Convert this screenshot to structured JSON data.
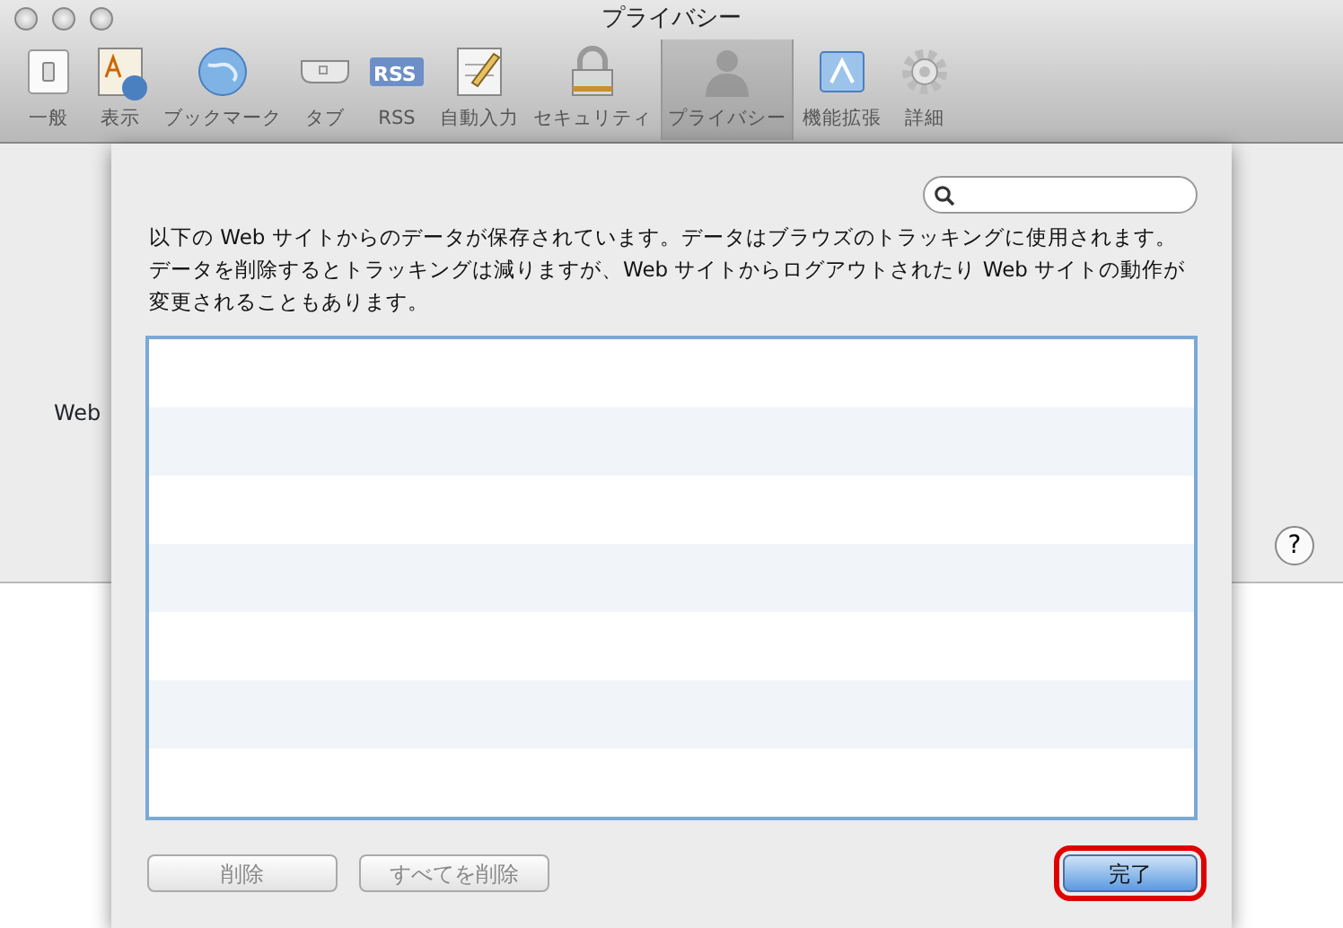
{
  "window": {
    "title": "プライバシー"
  },
  "toolbar": [
    {
      "label": "一般",
      "selected": false
    },
    {
      "label": "表示",
      "selected": false
    },
    {
      "label": "ブックマーク",
      "selected": false
    },
    {
      "label": "タブ",
      "selected": false
    },
    {
      "label": "RSS",
      "icon_text": "RSS",
      "selected": false
    },
    {
      "label": "自動入力",
      "selected": false
    },
    {
      "label": "セキュリティ",
      "selected": false
    },
    {
      "label": "プライバシー",
      "selected": true
    },
    {
      "label": "機能拡張",
      "selected": false
    },
    {
      "label": "詳細",
      "selected": false
    }
  ],
  "background": {
    "label": "Web",
    "help": "?"
  },
  "sheet": {
    "description": "以下の Web サイトからのデータが保存されています。データはブラウズのトラッキングに使用されます。データを削除するとトラッキングは減りますが、Web サイトからログアウトされたり Web サイトの動作が変更されることもあります。",
    "buttons": [
      {
        "label": "削除",
        "disabled": true,
        "default": false,
        "highlighted": false
      },
      {
        "label": "すべてを削除",
        "disabled": true,
        "default": false,
        "highlighted": false
      },
      {
        "label": "完了",
        "disabled": false,
        "default": true,
        "highlighted": true
      }
    ]
  }
}
